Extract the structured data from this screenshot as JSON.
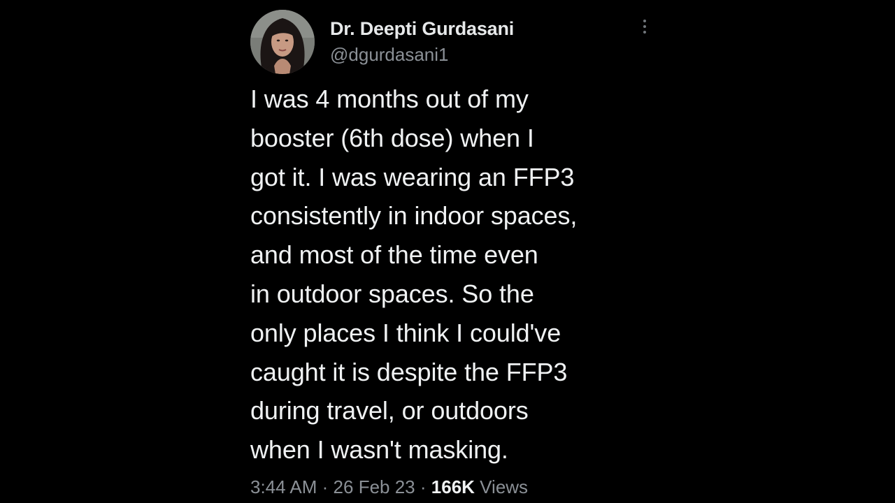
{
  "tweet": {
    "author": {
      "display_name": "Dr. Deepti Gurdasani",
      "handle": "@dgurdasani1",
      "avatar": "profile-photo"
    },
    "more_icon": "more-dots-vertical-icon",
    "text": "I was 4 months out of my\nbooster (6th dose) when I\ngot it. I was wearing an FFP3\nconsistently in indoor spaces,\nand most of the time even\nin outdoor spaces. So the\nonly places I think I could've\ncaught it is despite the FFP3\nduring travel, or outdoors\nwhen I wasn't masking.",
    "meta": {
      "time": "3:44 AM",
      "separator": "·",
      "date": "26 Feb 23",
      "views_count": "166K",
      "views_label": "Views"
    }
  },
  "colors": {
    "background": "#000000",
    "primary_text": "#e7e9ea",
    "secondary_text": "#8b9096"
  }
}
